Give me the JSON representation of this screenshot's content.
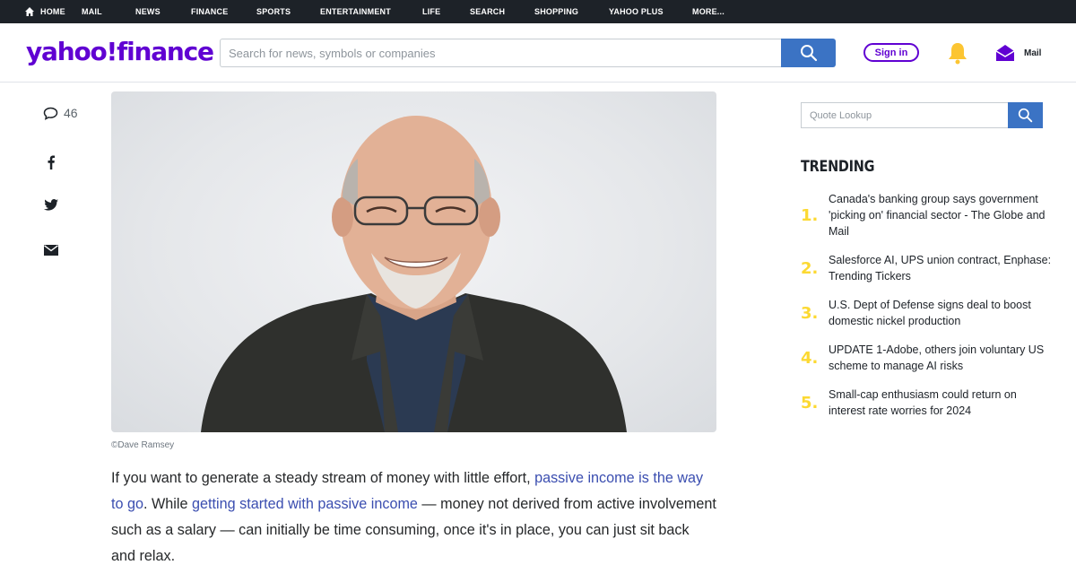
{
  "topnav": {
    "items": [
      "HOME",
      "MAIL",
      "NEWS",
      "FINANCE",
      "SPORTS",
      "ENTERTAINMENT",
      "LIFE",
      "SEARCH",
      "SHOPPING",
      "YAHOO PLUS",
      "MORE..."
    ],
    "active": "FINANCE"
  },
  "header": {
    "logo": "yahoo!finance",
    "search_placeholder": "Search for news, symbols or companies",
    "signin_label": "Sign in",
    "mail_label": "Mail",
    "brand_color": "#6001d2",
    "search_button_color": "#3b73c4"
  },
  "rail": {
    "comment_count": "46",
    "icons": [
      "comment-icon",
      "facebook-icon",
      "twitter-icon",
      "mail-icon"
    ]
  },
  "article": {
    "image_caption": "©Dave Ramsey",
    "p1_a": "If you want to generate a steady stream of money with little effort, ",
    "p1_link1": "passive income is the way to go",
    "p1_b": ". While ",
    "p1_link2": "getting started with passive income",
    "p1_c": " — money not derived from active involvement such as a salary — can initially be time consuming, once it's in place, you can just sit back and relax."
  },
  "sidebar": {
    "quote_placeholder": "Quote Lookup",
    "trending_title": "TRENDING",
    "trending": [
      {
        "num": "1.",
        "text": "Canada's banking group says government 'picking on' financial sector - The Globe and Mail"
      },
      {
        "num": "2.",
        "text": "Salesforce AI, UPS union contract, Enphase: Trending Tickers"
      },
      {
        "num": "3.",
        "text": "U.S. Dept of Defense signs deal to boost domestic nickel production"
      },
      {
        "num": "4.",
        "text": "UPDATE 1-Adobe, others join voluntary US scheme to manage AI risks"
      },
      {
        "num": "5.",
        "text": "Small-cap enthusiasm could return on interest rate worries for 2024"
      }
    ],
    "number_color": "#fcd932"
  }
}
